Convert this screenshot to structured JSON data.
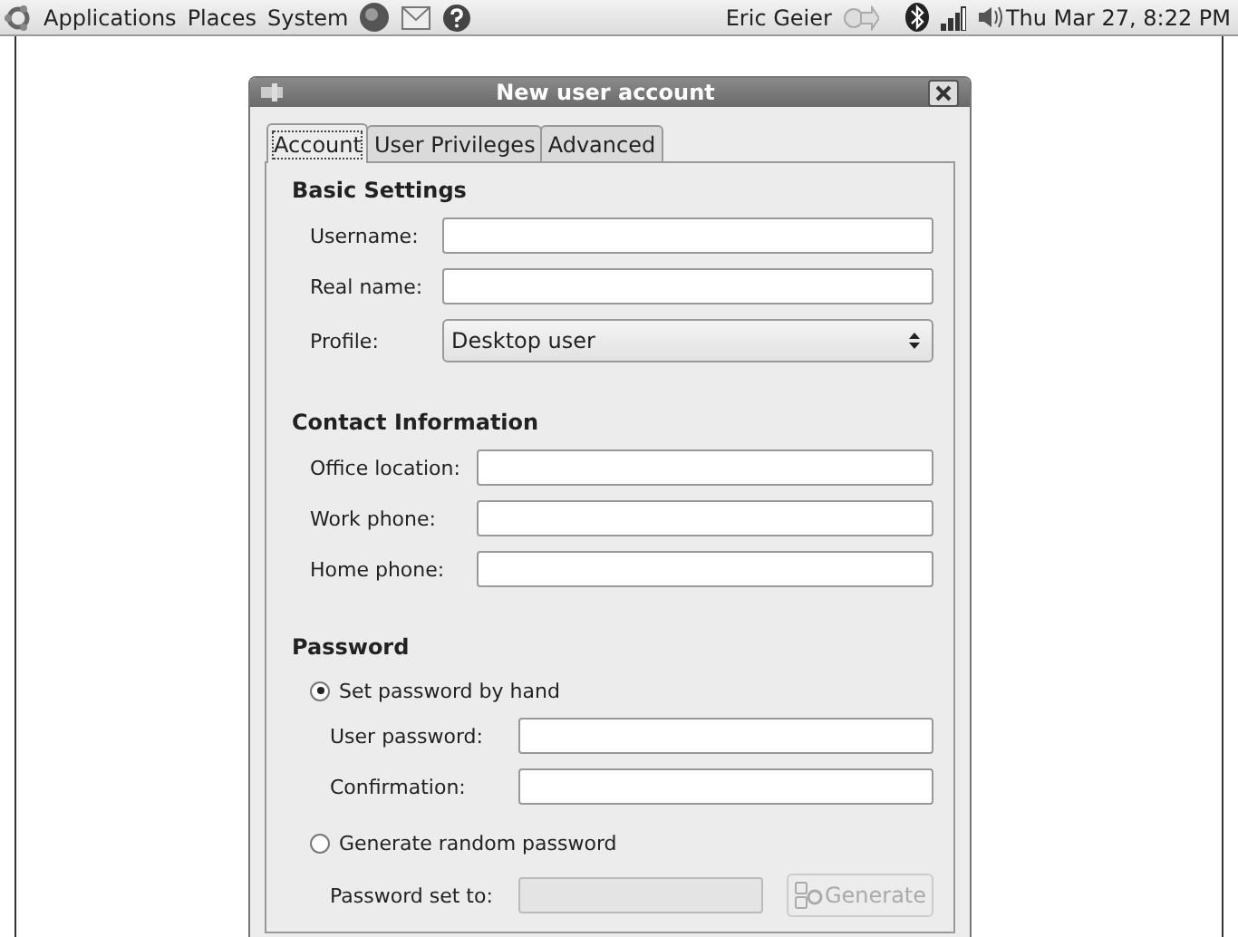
{
  "top_panel": {
    "menus": [
      "Applications",
      "Places",
      "System"
    ],
    "user": "Eric Geier",
    "clock": "Thu Mar 27,  8:22 PM"
  },
  "window": {
    "title": "New user account"
  },
  "tabs": [
    {
      "label": "Account",
      "selected": true
    },
    {
      "label": "User Privileges",
      "selected": false
    },
    {
      "label": "Advanced",
      "selected": false
    }
  ],
  "basic_settings": {
    "heading": "Basic Settings",
    "fields": [
      {
        "label": "Username:"
      },
      {
        "label": "Real name:"
      }
    ],
    "profile": {
      "label": "Profile:",
      "value": "Desktop user"
    }
  },
  "contact_information": {
    "heading": "Contact Information",
    "fields": [
      {
        "label": "Office location:"
      },
      {
        "label": "Work phone:"
      },
      {
        "label": "Home phone:"
      }
    ]
  },
  "password": {
    "heading": "Password",
    "options": [
      {
        "label": "Set password by hand",
        "selected": true
      },
      {
        "label": "Generate random password",
        "selected": false
      }
    ],
    "fields": [
      {
        "label": "User password:"
      },
      {
        "label": "Confirmation:"
      }
    ],
    "generated": {
      "label": "Password set to:",
      "disabled": true
    },
    "generate_button": {
      "label": "Generate",
      "disabled": true
    }
  }
}
